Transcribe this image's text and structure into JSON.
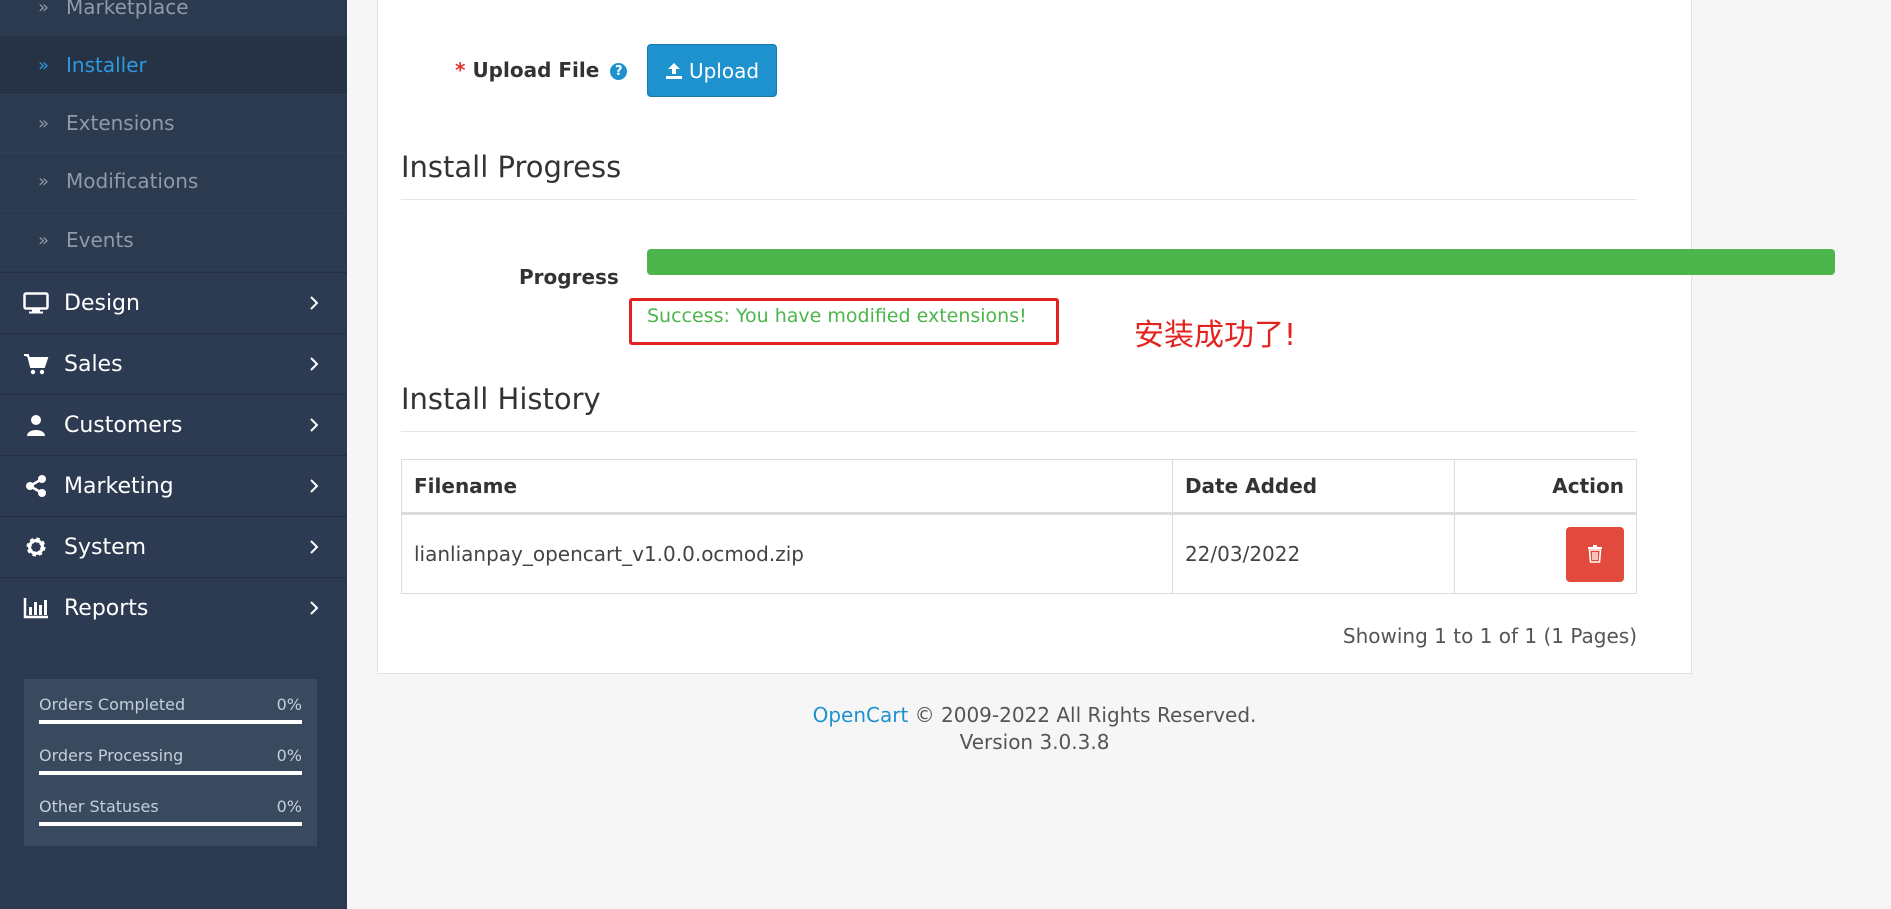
{
  "sidebar": {
    "sub_items": [
      {
        "label": "Marketplace"
      },
      {
        "label": "Installer"
      },
      {
        "label": "Extensions"
      },
      {
        "label": "Modifications"
      },
      {
        "label": "Events"
      }
    ],
    "menu": [
      {
        "label": "Design",
        "icon": "monitor-icon"
      },
      {
        "label": "Sales",
        "icon": "cart-icon"
      },
      {
        "label": "Customers",
        "icon": "user-icon"
      },
      {
        "label": "Marketing",
        "icon": "share-icon"
      },
      {
        "label": "System",
        "icon": "gear-icon"
      },
      {
        "label": "Reports",
        "icon": "bar-chart-icon"
      }
    ],
    "stats": [
      {
        "label": "Orders Completed",
        "value": "0%",
        "percent": 100
      },
      {
        "label": "Orders Processing",
        "value": "0%",
        "percent": 100
      },
      {
        "label": "Other Statuses",
        "value": "0%",
        "percent": 100
      }
    ]
  },
  "upload": {
    "required_mark": "*",
    "label": "Upload File",
    "help": "?",
    "button": "Upload"
  },
  "progress": {
    "title": "Install Progress",
    "label": "Progress",
    "percent": 100,
    "message": "Success: You have modified extensions!",
    "annotation": "安装成功了!"
  },
  "history": {
    "title": "Install History",
    "columns": [
      "Filename",
      "Date Added",
      "Action"
    ],
    "rows": [
      {
        "filename": "lianlianpay_opencart_v1.0.0.ocmod.zip",
        "date_added": "22/03/2022"
      }
    ],
    "pagination": "Showing 1 to 1 of 1 (1 Pages)"
  },
  "footer": {
    "brand": "OpenCart",
    "copyright": " © 2009-2022 All Rights Reserved.",
    "version": "Version 3.0.3.8"
  },
  "colors": {
    "sidebar_bg": "#2b3a4f",
    "accent_blue": "#1e91cf",
    "success_green": "#4cb64c",
    "danger_red": "#e14a3c"
  }
}
